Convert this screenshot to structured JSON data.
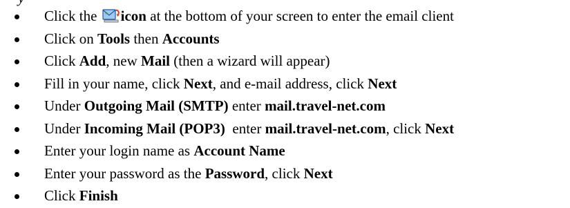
{
  "heading_fragment": "y",
  "steps": [
    {
      "before": "Click  the ",
      "icon": "email-client-icon",
      "bold1": "icon",
      "after": " at the bottom of your screen to enter the email client"
    },
    {
      "t1": "Click on ",
      "b1": "Tools",
      "t2": " then ",
      "b2": "Accounts"
    },
    {
      "t1": "Click ",
      "b1": "Add",
      "t2": ", new ",
      "b2": "Mail",
      "t3": " (then a wizard will appear)"
    },
    {
      "t1": "Fill in your name, click ",
      "b1": "Next",
      "t2": ", and e-mail address, click ",
      "b2": "Next"
    },
    {
      "t1": "Under ",
      "b1": "Outgoing Mail (SMTP)",
      "t2": " enter ",
      "b2": "mail.travel-net.com"
    },
    {
      "t1": "Under ",
      "b1": "Incoming Mail (POP3)",
      "t2": "  enter ",
      "b2": "mail.travel-net.com",
      "t3": ", click ",
      "b3": "Next"
    },
    {
      "t1": "Enter your login name as ",
      "b1": "Account Name"
    },
    {
      "t1": "Enter your password as the ",
      "b1": "Password",
      "t2": ", click ",
      "b2": "Next"
    },
    {
      "t1": "Click ",
      "b1": "Finish"
    }
  ]
}
